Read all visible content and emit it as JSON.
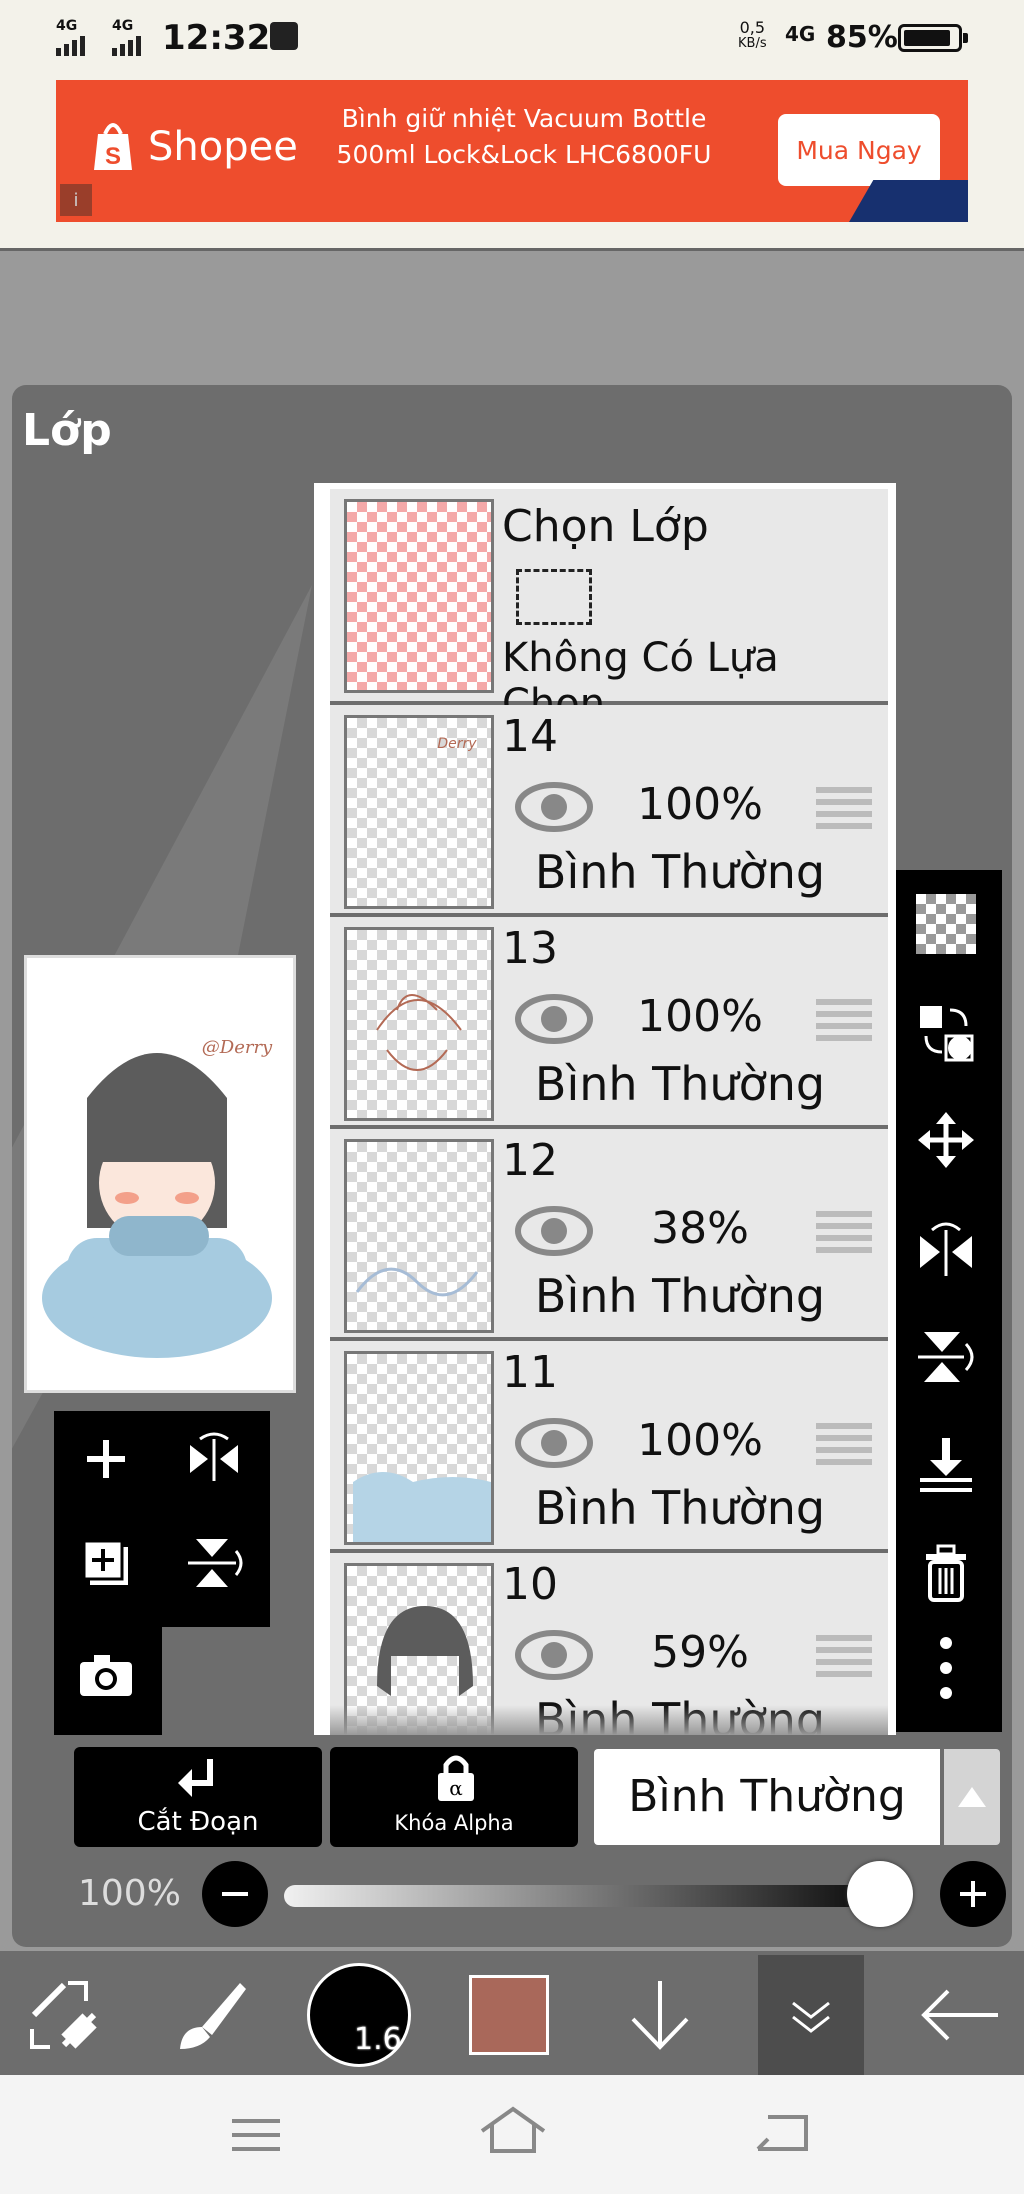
{
  "status": {
    "time": "12:32",
    "net1": "4G",
    "net2": "4G",
    "speed": "0,5",
    "speed_unit": "KB/s",
    "net3": "4G",
    "battery": "85%"
  },
  "ad": {
    "brand": "Shopee",
    "line1": "Bình giữ nhiệt Vacuum Bottle",
    "line2": "500ml Lock&Lock LHC6800FU",
    "cta": "Mua Ngay",
    "info": "i"
  },
  "panel": {
    "title": "Lớp"
  },
  "selection_layer": {
    "title": "Chọn Lớp",
    "subtitle": "Không Có Lựa Chọn"
  },
  "layers": [
    {
      "number": "14",
      "opacity": "100%",
      "blend": "Bình Thường"
    },
    {
      "number": "13",
      "opacity": "100%",
      "blend": "Bình Thường"
    },
    {
      "number": "12",
      "opacity": "38%",
      "blend": "Bình Thường"
    },
    {
      "number": "11",
      "opacity": "100%",
      "blend": "Bình Thường"
    },
    {
      "number": "10",
      "opacity": "59%",
      "blend": "Bình Thường"
    }
  ],
  "preview": {
    "signature": "@Derry"
  },
  "bottom_controls": {
    "clip_label": "Cắt Đoạn",
    "alpha_label": "Khóa Alpha",
    "blend_mode": "Bình Thường"
  },
  "opacity_slider": {
    "label": "100%",
    "value": 1.0
  },
  "toolbar": {
    "brush_size": "1.6",
    "color": "#a9685a"
  },
  "colors": {
    "shopee": "#ee4d2d",
    "panel": "#6d6d6d",
    "layer_bg": "#e8e8e8"
  }
}
